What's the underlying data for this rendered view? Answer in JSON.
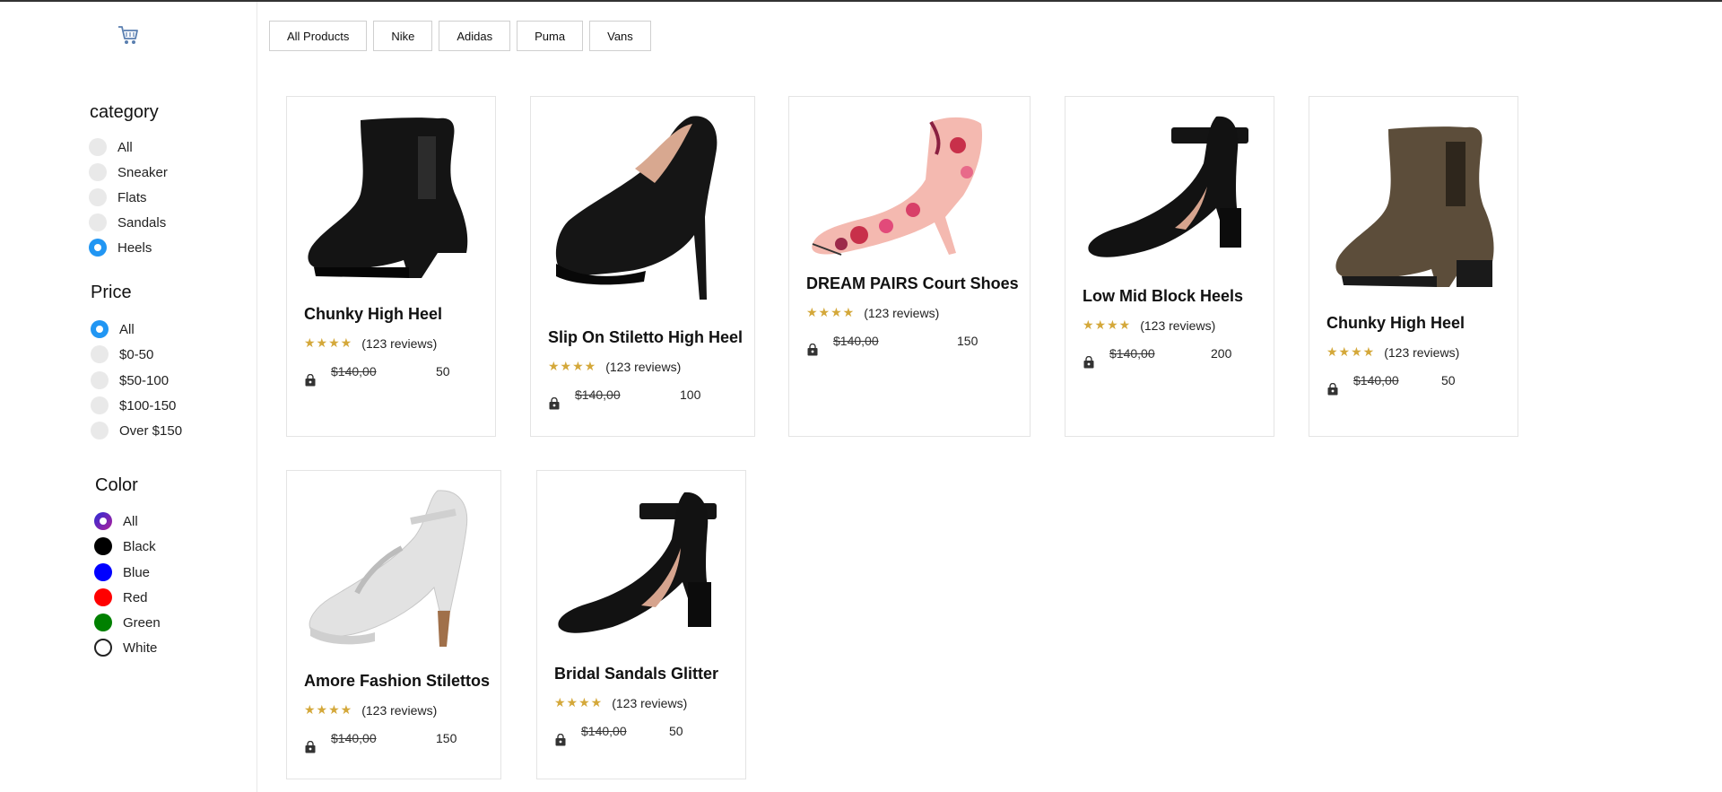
{
  "app": {
    "logo_icon": "shopping-cart-icon"
  },
  "filters": {
    "category": {
      "title": "category",
      "options": [
        "All",
        "Sneaker",
        "Flats",
        "Sandals",
        "Heels"
      ],
      "selected": "Heels"
    },
    "price": {
      "title": "Price",
      "options": [
        "All",
        "$0-50",
        "$50-100",
        "$100-150",
        "Over $150"
      ],
      "selected": "All"
    },
    "color": {
      "title": "Color",
      "options": [
        {
          "label": "All",
          "color": "gradient"
        },
        {
          "label": "Black",
          "color": "#000000"
        },
        {
          "label": "Blue",
          "color": "#0000ff"
        },
        {
          "label": "Red",
          "color": "#ff0000"
        },
        {
          "label": "Green",
          "color": "#008000"
        },
        {
          "label": "White",
          "color": "#ffffff"
        }
      ],
      "selected": "All"
    }
  },
  "brands": [
    "All Products",
    "Nike",
    "Adidas",
    "Puma",
    "Vans"
  ],
  "products": [
    {
      "title": "Chunky High Heel",
      "stars": "★★★★",
      "reviews": "(123 reviews)",
      "old_price": "$140,00",
      "price": "50",
      "image": "black-suede-chelsea-ankle-boot"
    },
    {
      "title": "Slip On Stiletto High Heel",
      "stars": "★★★★",
      "reviews": "(123 reviews)",
      "old_price": "$140,00",
      "price": "100",
      "image": "black-platform-stiletto-pump"
    },
    {
      "title": "DREAM PAIRS Court Shoes",
      "stars": "★★★★",
      "reviews": "(123 reviews)",
      "old_price": "$140,00",
      "price": "150",
      "image": "floral-pointed-ankle-strap-heel"
    },
    {
      "title": "Low Mid Block Heels",
      "stars": "★★★★",
      "reviews": "(123 reviews)",
      "old_price": "$140,00",
      "price": "200",
      "image": "black-ankle-strap-block-heel"
    },
    {
      "title": "Chunky High Heel",
      "stars": "★★★★",
      "reviews": "(123 reviews)",
      "old_price": "$140,00",
      "price": "50",
      "image": "brown-chelsea-ankle-boot"
    },
    {
      "title": "Amore Fashion Stilettos",
      "stars": "★★★★",
      "reviews": "(123 reviews)",
      "old_price": "$140,00",
      "price": "150",
      "image": "silver-glitter-t-strap-heel"
    },
    {
      "title": "Bridal Sandals Glitter",
      "stars": "★★★★",
      "reviews": "(123 reviews)",
      "old_price": "$140,00",
      "price": "50",
      "image": "black-ankle-strap-block-pump"
    }
  ],
  "colors": {
    "star": "#d4a83a",
    "radio_checked": "#2196f3",
    "radio_unchecked": "#e9e9e9"
  }
}
